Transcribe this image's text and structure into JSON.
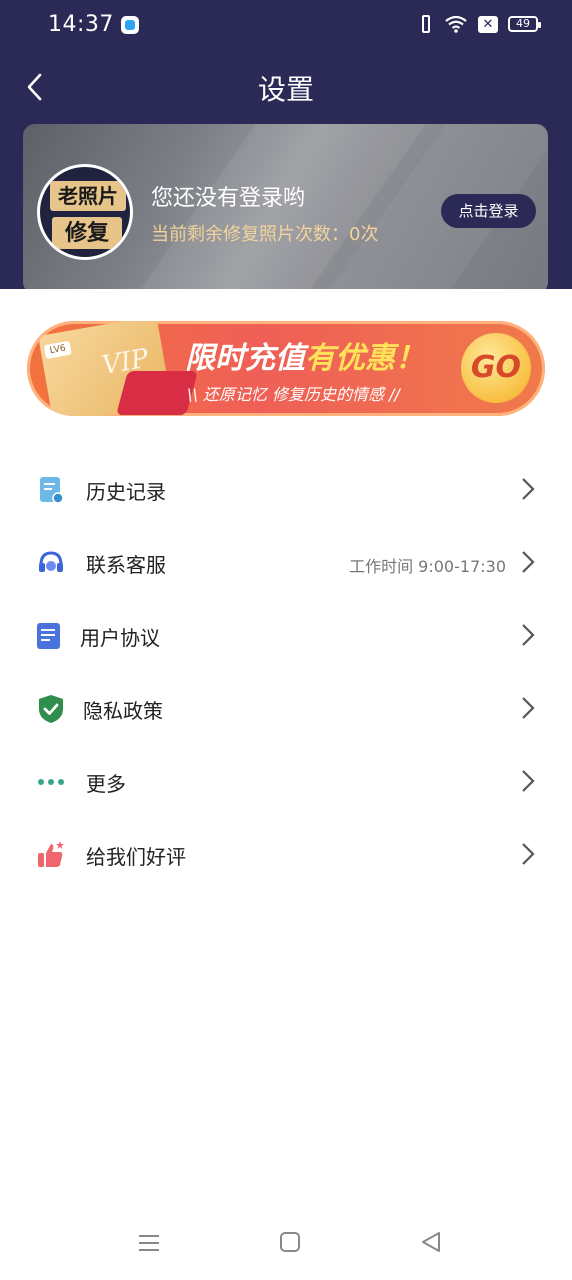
{
  "status": {
    "time": "14:37",
    "battery": "49"
  },
  "header": {
    "title": "设置"
  },
  "user": {
    "avatar_line1": "老照片",
    "avatar_line2": "修复",
    "title": "您还没有登录哟",
    "remaining": "当前剩余修复照片次数：0次",
    "login_button": "点击登录"
  },
  "banner": {
    "title_part1": "限时充值",
    "title_part2": "有优惠！",
    "subtitle": "\\\\ 还原记忆 修复历史的情感 //",
    "go": "GO",
    "vip": "VIP",
    "level": "LV6"
  },
  "menu": [
    {
      "label": "历史记录",
      "icon": "history-doc-icon"
    },
    {
      "label": "联系客服",
      "icon": "headset-icon",
      "extra": "工作时间 9:00-17:30"
    },
    {
      "label": "用户协议",
      "icon": "agreement-icon"
    },
    {
      "label": "隐私政策",
      "icon": "shield-check-icon"
    },
    {
      "label": "更多",
      "icon": "more-dots-icon"
    },
    {
      "label": "给我们好评",
      "icon": "thumbs-up-icon"
    }
  ],
  "colors": {
    "header_bg": "#2b2a57",
    "accent_gold": "#f2d39a"
  }
}
